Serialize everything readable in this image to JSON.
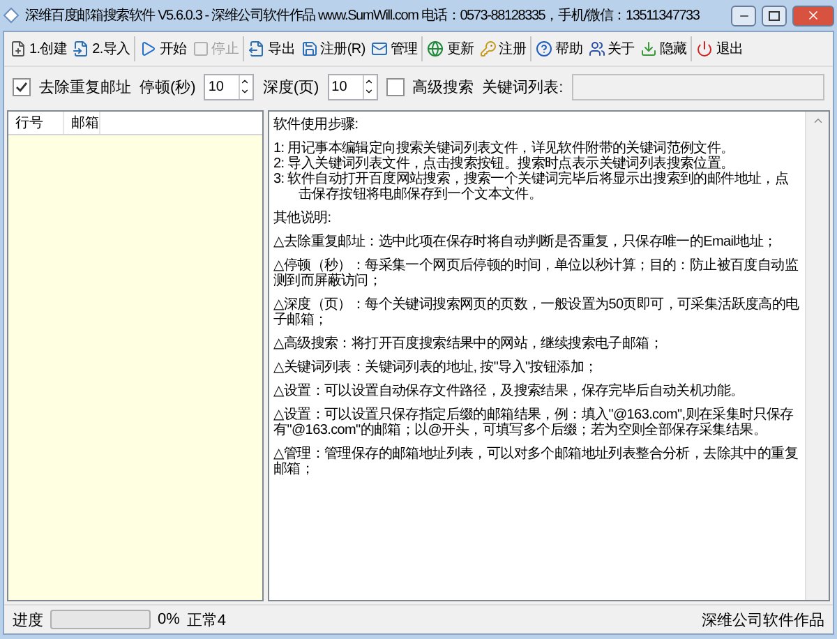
{
  "window": {
    "title": "深维百度邮箱搜索软件 V5.6.0.3 - 深维公司软件作品 www.SumWill.com  电话：0573-88128335，手机/微信：13511347733"
  },
  "toolbar": [
    {
      "kind": "button",
      "label": "1.创建",
      "disabled": false
    },
    {
      "kind": "button",
      "label": "2.导入",
      "disabled": false
    },
    {
      "kind": "separator"
    },
    {
      "kind": "button",
      "label": "开始",
      "disabled": false
    },
    {
      "kind": "button",
      "label": "停止",
      "disabled": true
    },
    {
      "kind": "separator"
    },
    {
      "kind": "button",
      "label": "导出",
      "disabled": false
    },
    {
      "kind": "button",
      "label": "注册(R)",
      "disabled": false
    },
    {
      "kind": "button",
      "label": "管理",
      "disabled": false
    },
    {
      "kind": "separator"
    },
    {
      "kind": "button",
      "label": "更新",
      "disabled": false
    },
    {
      "kind": "button",
      "label": "注册",
      "disabled": false
    },
    {
      "kind": "separator"
    },
    {
      "kind": "button",
      "label": "帮助",
      "disabled": false
    },
    {
      "kind": "button",
      "label": "关于",
      "disabled": false
    },
    {
      "kind": "button",
      "label": "隐藏",
      "disabled": false
    },
    {
      "kind": "separator"
    },
    {
      "kind": "button",
      "label": "退出",
      "disabled": false
    }
  ],
  "options": {
    "dedupe": {
      "label": "去除重复邮址",
      "checked": true
    },
    "pause": {
      "label": "停顿(秒)",
      "value": "10"
    },
    "depth": {
      "label": "深度(页)",
      "value": "10"
    },
    "advanced": {
      "label": "高级搜索",
      "checked": false
    },
    "keywords": {
      "label": "关键词列表:"
    }
  },
  "table": {
    "columns": [
      "行号",
      "邮箱"
    ]
  },
  "help_text": [
    {
      "kind": "para",
      "text": "软件使用步骤:"
    },
    {
      "kind": "steps",
      "lines": [
        "1: 用记事本编辑定向搜索关键词列表文件，详见软件附带的关键词范例文件。",
        "2: 导入关键词列表文件，点击搜索按钮。搜索时点表示关键词列表搜索位置。",
        "3: 软件自动打开百度网站搜索，搜索一个关键词完毕后将显示出搜索到的邮件地址，点击保存按钮将电邮保存到一个文本文件。"
      ]
    },
    {
      "kind": "para",
      "text": "其他说明:"
    },
    {
      "kind": "para",
      "text": "△去除重复邮址：选中此项在保存时将自动判断是否重复，只保存唯一的Email地址；"
    },
    {
      "kind": "para",
      "text": "△停顿（秒）：每采集一个网页后停顿的时间，单位以秒计算；目的：防止被百度自动监测到而屏蔽访问；"
    },
    {
      "kind": "para",
      "text": "△深度（页）：每个关键词搜索网页的页数，一般设置为50页即可，可采集活跃度高的电子邮箱；"
    },
    {
      "kind": "para",
      "text": "△高级搜索：将打开百度搜索结果中的网站，继续搜索电子邮箱；"
    },
    {
      "kind": "para",
      "text": "△关键词列表：关键词列表的地址, 按\"导入\"按钮添加；"
    },
    {
      "kind": "para",
      "text": "△设置：可以设置自动保存文件路径，及搜索结果，保存完毕后自动关机功能。"
    },
    {
      "kind": "para",
      "text": "△设置：可以设置只保存指定后缀的邮箱结果，例：填入\"@163.com\",则在采集时只保存有\"@163.com\"的邮箱；以@开头，可填写多个后缀；若为空则全部保存采集结果。"
    },
    {
      "kind": "para",
      "text": "△管理：管理保存的邮箱地址列表，可以对多个邮箱地址列表整合分析，去除其中的重复邮箱；"
    }
  ],
  "status_bar": {
    "label": "进度",
    "level": 0,
    "percent": "0%",
    "state": "正常4",
    "credit": "深维公司软件作品"
  }
}
